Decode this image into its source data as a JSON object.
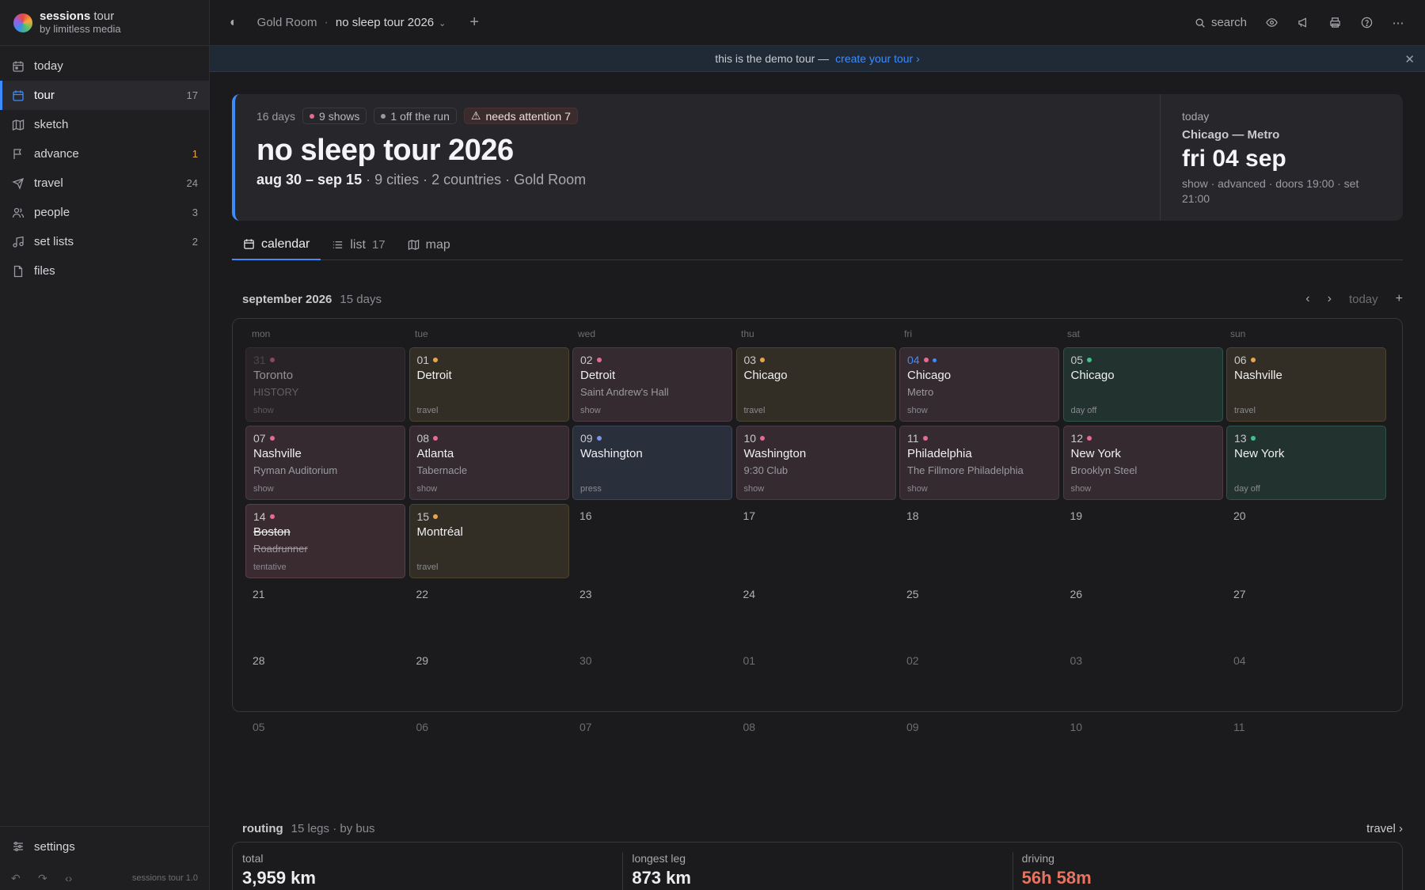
{
  "brand": {
    "name": "sessions",
    "name_suffix": "tour",
    "sub": "by limitless media"
  },
  "sidebar": {
    "items": [
      {
        "label": "today",
        "count": ""
      },
      {
        "label": "tour",
        "count": "17"
      },
      {
        "label": "sketch",
        "count": ""
      },
      {
        "label": "advance",
        "count": "1"
      },
      {
        "label": "travel",
        "count": "24"
      },
      {
        "label": "people",
        "count": "3"
      },
      {
        "label": "set lists",
        "count": "2"
      },
      {
        "label": "files",
        "count": ""
      }
    ],
    "settings": "settings",
    "version": "sessions tour 1.0"
  },
  "topbar": {
    "crumb_org": "Gold Room",
    "crumb_sep": "·",
    "crumb_tour": "no sleep tour 2026",
    "search_label": "search"
  },
  "banner": {
    "text": "this is the demo tour —",
    "link": "create your tour ›"
  },
  "hero": {
    "days": "16 days",
    "shows": "9 shows",
    "off_run": "1 off the run",
    "attention": "needs attention 7",
    "title": "no sleep tour 2026",
    "dates": "aug 30 – sep 15",
    "rest": " · 9 cities · 2 countries · Gold Room",
    "today_label": "today",
    "today_venue": "Chicago — Metro",
    "today_date": "fri 04 sep",
    "today_meta": "show · advanced · doors 19:00 · set 21:00"
  },
  "tabs": [
    {
      "label": "calendar",
      "count": ""
    },
    {
      "label": "list",
      "count": "17"
    },
    {
      "label": "map",
      "count": ""
    }
  ],
  "calendar": {
    "month": "september 2026",
    "days": "15 days",
    "today_btn": "today",
    "dow": [
      "mon",
      "tue",
      "wed",
      "thu",
      "fri",
      "sat",
      "sun"
    ],
    "events": [
      {
        "day": "31",
        "city": "Toronto",
        "venue": "HISTORY",
        "kind": "show"
      },
      {
        "day": "01",
        "city": "Detroit",
        "venue": "",
        "kind": "travel"
      },
      {
        "day": "02",
        "city": "Detroit",
        "venue": "Saint Andrew's Hall",
        "kind": "show"
      },
      {
        "day": "03",
        "city": "Chicago",
        "venue": "",
        "kind": "travel"
      },
      {
        "day": "04",
        "city": "Chicago",
        "venue": "Metro",
        "kind": "show"
      },
      {
        "day": "05",
        "city": "Chicago",
        "venue": "",
        "kind": "day off"
      },
      {
        "day": "06",
        "city": "Nashville",
        "venue": "",
        "kind": "travel"
      },
      {
        "day": "07",
        "city": "Nashville",
        "venue": "Ryman Auditorium",
        "kind": "show"
      },
      {
        "day": "08",
        "city": "Atlanta",
        "venue": "Tabernacle",
        "kind": "show"
      },
      {
        "day": "09",
        "city": "Washington",
        "venue": "",
        "kind": "press"
      },
      {
        "day": "10",
        "city": "Washington",
        "venue": "9:30 Club",
        "kind": "show"
      },
      {
        "day": "11",
        "city": "Philadelphia",
        "venue": "The Fillmore Philadelphia",
        "kind": "show"
      },
      {
        "day": "12",
        "city": "New York",
        "venue": "Brooklyn Steel",
        "kind": "show"
      },
      {
        "day": "13",
        "city": "New York",
        "venue": "",
        "kind": "day off"
      },
      {
        "day": "14",
        "city": "Boston",
        "venue": "Roadrunner",
        "kind": "tentative"
      },
      {
        "day": "15",
        "city": "Montréal",
        "venue": "",
        "kind": "travel"
      }
    ],
    "empty_days": [
      "16",
      "17",
      "18",
      "19",
      "20",
      "21",
      "22",
      "23",
      "24",
      "25",
      "26",
      "27",
      "28",
      "29",
      "30",
      "01",
      "02",
      "03",
      "04",
      "05",
      "06",
      "07",
      "08",
      "09",
      "10",
      "11"
    ]
  },
  "routing": {
    "title": "routing",
    "sub": "15 legs · by bus",
    "link": "travel ›",
    "stats": [
      {
        "label": "total",
        "value": "3,959 km"
      },
      {
        "label": "longest leg",
        "value": "873 km"
      },
      {
        "label": "driving",
        "value": "56h 58m"
      }
    ]
  },
  "colors": {
    "accent": "#3d8bfd",
    "show_dot": "#e86a8e",
    "travel_dot": "#e8a54b",
    "off_dot": "#3fc28a",
    "press_dot": "#7c93e6",
    "alert": "#e8735e"
  }
}
